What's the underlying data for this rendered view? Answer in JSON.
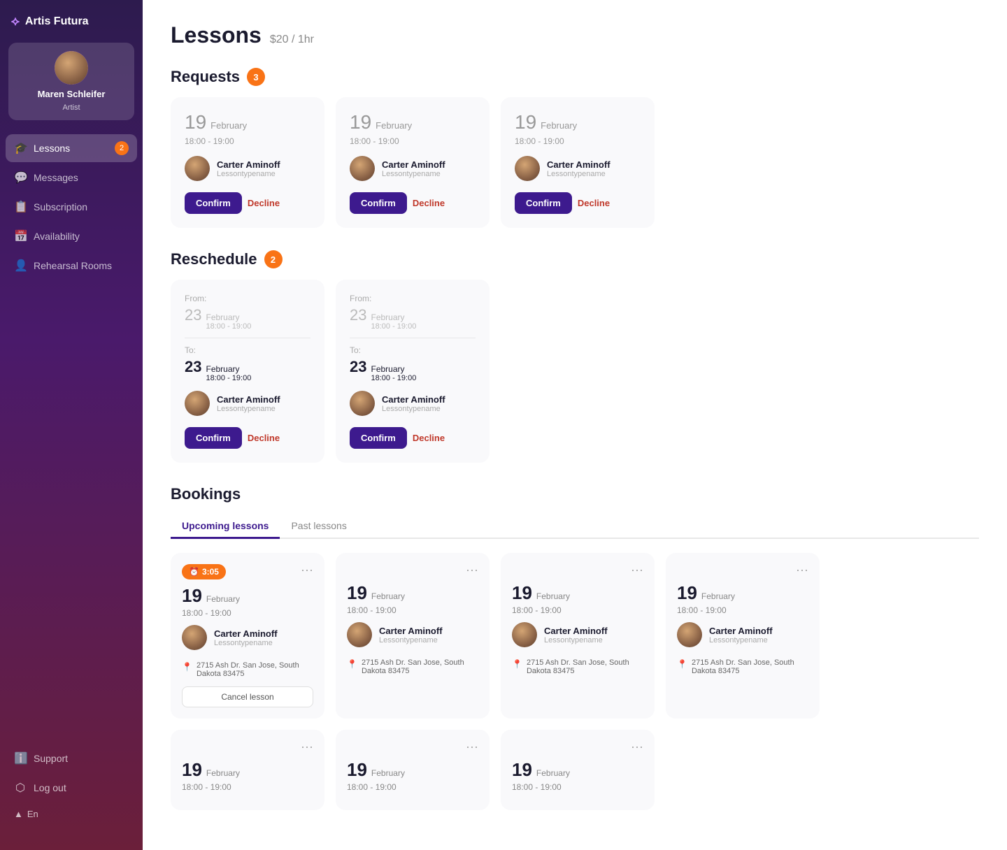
{
  "app": {
    "name": "Artis Futura",
    "logo_icon": "⟡"
  },
  "sidebar": {
    "profile": {
      "name": "Maren Schleifer",
      "role": "Artist"
    },
    "nav_items": [
      {
        "id": "lessons",
        "label": "Lessons",
        "icon": "🎓",
        "badge": 2,
        "active": true
      },
      {
        "id": "messages",
        "label": "Messages",
        "icon": "💬",
        "badge": null,
        "active": false
      },
      {
        "id": "subscription",
        "label": "Subscription",
        "icon": "📅",
        "badge": null,
        "active": false
      },
      {
        "id": "availability",
        "label": "Availability",
        "icon": "📆",
        "badge": null,
        "active": false
      },
      {
        "id": "rehearsal-rooms",
        "label": "Rehearsal Rooms",
        "icon": "👤",
        "badge": null,
        "active": false
      }
    ],
    "bottom_items": [
      {
        "id": "support",
        "label": "Support",
        "icon": "ℹ️"
      },
      {
        "id": "logout",
        "label": "Log out",
        "icon": "🚪"
      }
    ],
    "lang": "En"
  },
  "page": {
    "title": "Lessons",
    "price": "$20 / 1hr"
  },
  "requests": {
    "label": "Requests",
    "count": 3,
    "cards": [
      {
        "day": "19",
        "month": "February",
        "time": "18:00 - 19:00",
        "person_name": "Carter Aminoff",
        "person_type": "Lessontypename",
        "confirm_label": "Confirm",
        "decline_label": "Decline"
      },
      {
        "day": "19",
        "month": "February",
        "time": "18:00 - 19:00",
        "person_name": "Carter Aminoff",
        "person_type": "Lessontypename",
        "confirm_label": "Confirm",
        "decline_label": "Decline"
      },
      {
        "day": "19",
        "month": "February",
        "time": "18:00 - 19:00",
        "person_name": "Carter Aminoff",
        "person_type": "Lessontypename",
        "confirm_label": "Confirm",
        "decline_label": "Decline"
      }
    ]
  },
  "reschedule": {
    "label": "Reschedule",
    "count": 2,
    "cards": [
      {
        "from_day": "23",
        "from_month": "February",
        "from_time": "18:00 - 19:00",
        "to_day": "23",
        "to_month": "February",
        "to_time": "18:00 - 19:00",
        "person_name": "Carter Aminoff",
        "person_type": "Lessontypename",
        "confirm_label": "Confirm",
        "decline_label": "Decline"
      },
      {
        "from_day": "23",
        "from_month": "February",
        "from_time": "18:00 - 19:00",
        "to_day": "23",
        "to_month": "February",
        "to_time": "18:00 - 19:00",
        "person_name": "Carter Aminoff",
        "person_type": "Lessontypename",
        "confirm_label": "Confirm",
        "decline_label": "Decline"
      }
    ]
  },
  "bookings": {
    "label": "Bookings",
    "tabs": [
      {
        "id": "upcoming",
        "label": "Upcoming lessons",
        "active": true
      },
      {
        "id": "past",
        "label": "Past lessons",
        "active": false
      }
    ],
    "cards": [
      {
        "day": "19",
        "month": "February",
        "time": "18:00 - 19:00",
        "person_name": "Carter Aminoff",
        "person_type": "Lessontypename",
        "address": "2715 Ash Dr. San Jose, South Dakota 83475",
        "timer": "3:05",
        "has_timer": true,
        "cancel_label": "Cancel lesson"
      },
      {
        "day": "19",
        "month": "February",
        "time": "18:00 - 19:00",
        "person_name": "Carter Aminoff",
        "person_type": "Lessontypename",
        "address": "2715 Ash Dr. San Jose, South Dakota 83475",
        "has_timer": false
      },
      {
        "day": "19",
        "month": "February",
        "time": "18:00 - 19:00",
        "person_name": "Carter Aminoff",
        "person_type": "Lessontypename",
        "address": "2715 Ash Dr. San Jose, South Dakota 83475",
        "has_timer": false
      },
      {
        "day": "19",
        "month": "February",
        "time": "18:00 - 19:00",
        "person_name": "Carter Aminoff",
        "person_type": "Lessontypename",
        "address": "2715 Ash Dr. San Jose, South Dakota 83475",
        "has_timer": false
      }
    ],
    "second_row_cards": [
      {
        "day": "19",
        "month": "February",
        "time": "18:00 - 19:00",
        "has_timer": false
      },
      {
        "day": "19",
        "month": "February",
        "time": "18:00 - 19:00",
        "has_timer": false
      },
      {
        "day": "19",
        "month": "February",
        "time": "18:00 - 19:00",
        "has_timer": false
      }
    ]
  }
}
